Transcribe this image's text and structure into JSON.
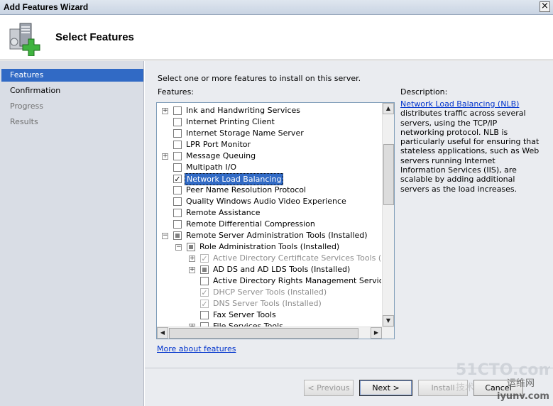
{
  "window": {
    "title": "Add Features Wizard",
    "close_glyph": "×"
  },
  "header": {
    "title": "Select Features",
    "icon": "server-add-icon"
  },
  "nav": [
    {
      "label": "Features",
      "state": "active"
    },
    {
      "label": "Confirmation",
      "state": "normal"
    },
    {
      "label": "Progress",
      "state": "disabled"
    },
    {
      "label": "Results",
      "state": "disabled"
    }
  ],
  "content": {
    "instruction": "Select one or more features to install on this server.",
    "features_label": "Features:",
    "description_label": "Description:",
    "description_link": "Network Load Balancing (NLB)",
    "description_text": "distributes traffic across several servers, using the TCP/IP networking protocol. NLB is particularly useful for ensuring that stateless applications, such as Web servers running Internet Information Services (IIS), are scalable by adding additional servers as the load increases.",
    "more_link": "More about features"
  },
  "features": [
    {
      "label": "Ink and Handwriting Services",
      "level": 0,
      "expander": "+",
      "check": "none"
    },
    {
      "label": "Internet Printing Client",
      "level": 0,
      "expander": "",
      "check": "none"
    },
    {
      "label": "Internet Storage Name Server",
      "level": 0,
      "expander": "",
      "check": "none"
    },
    {
      "label": "LPR Port Monitor",
      "level": 0,
      "expander": "",
      "check": "none"
    },
    {
      "label": "Message Queuing",
      "level": 0,
      "expander": "+",
      "check": "none"
    },
    {
      "label": "Multipath I/O",
      "level": 0,
      "expander": "",
      "check": "none"
    },
    {
      "label": "Network Load Balancing",
      "level": 0,
      "expander": "",
      "check": "checked",
      "selected": true
    },
    {
      "label": "Peer Name Resolution Protocol",
      "level": 0,
      "expander": "",
      "check": "none"
    },
    {
      "label": "Quality Windows Audio Video Experience",
      "level": 0,
      "expander": "",
      "check": "none"
    },
    {
      "label": "Remote Assistance",
      "level": 0,
      "expander": "",
      "check": "none"
    },
    {
      "label": "Remote Differential Compression",
      "level": 0,
      "expander": "",
      "check": "none"
    },
    {
      "label": "Remote Server Administration Tools  (Installed)",
      "level": 0,
      "expander": "−",
      "check": "partial"
    },
    {
      "label": "Role Administration Tools  (Installed)",
      "level": 1,
      "expander": "−",
      "check": "partial"
    },
    {
      "label": "Active Directory Certificate Services Tools  (Insta",
      "level": 2,
      "expander": "+",
      "check": "grey",
      "grey": true
    },
    {
      "label": "AD DS and AD LDS Tools  (Installed)",
      "level": 2,
      "expander": "+",
      "check": "partial"
    },
    {
      "label": "Active Directory Rights Management Services Too",
      "level": 2,
      "expander": "",
      "check": "none"
    },
    {
      "label": "DHCP Server Tools  (Installed)",
      "level": 2,
      "expander": "",
      "check": "grey",
      "grey": true
    },
    {
      "label": "DNS Server Tools  (Installed)",
      "level": 2,
      "expander": "",
      "check": "grey",
      "grey": true
    },
    {
      "label": "Fax Server Tools",
      "level": 2,
      "expander": "",
      "check": "none"
    },
    {
      "label": "File Services Tools",
      "level": 2,
      "expander": "+",
      "check": "none"
    }
  ],
  "buttons": {
    "previous": "< Previous",
    "next": "Next >",
    "install": "Install",
    "cancel": "Cancel"
  },
  "watermark": {
    "line1": "51CTO.com",
    "line2": "运维网",
    "line3": "iyunv.com",
    "line4": "技术"
  }
}
